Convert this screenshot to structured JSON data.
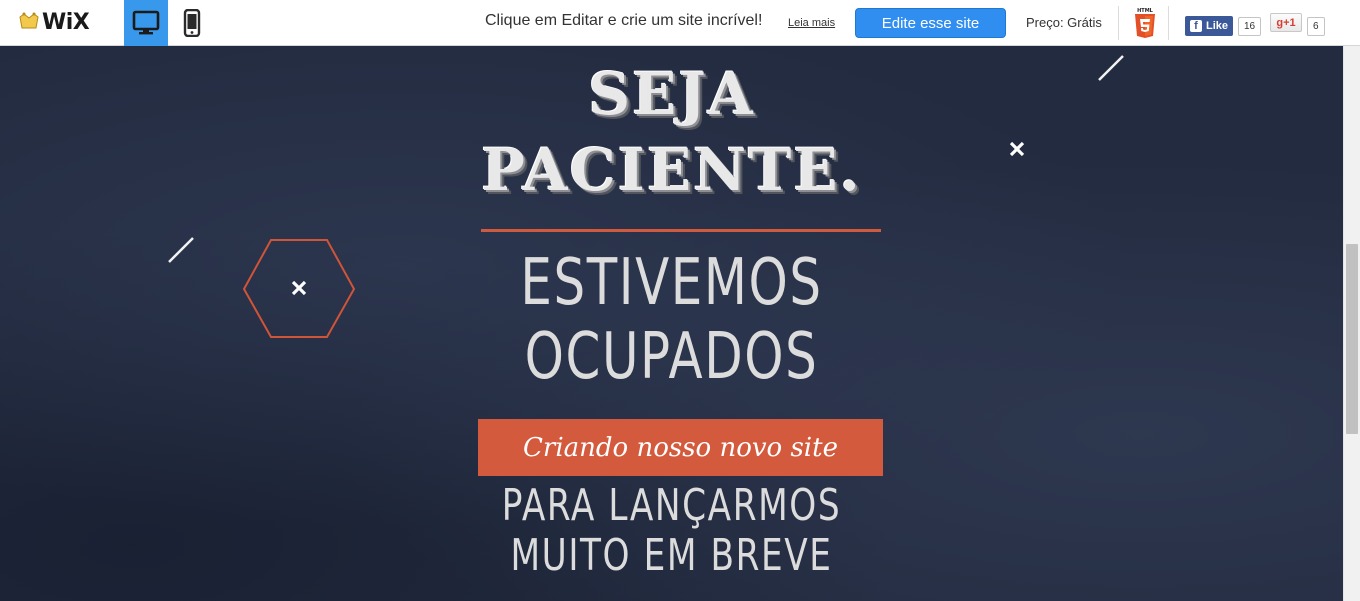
{
  "toolbar": {
    "logo_text": "WiX",
    "device_desktop": "desktop-icon",
    "device_mobile": "mobile-icon",
    "promo_text": "Clique em Editar e crie um site incrível!",
    "more_link": "Leia mais",
    "edit_button": "Edite esse site",
    "price_text": "Preço: Grátis",
    "html5_label": "HTML",
    "fb_like_label": "Like",
    "fb_count": "16",
    "gplus_label": "g+1",
    "gplus_count": "6"
  },
  "site": {
    "headline_line1": "SEJA",
    "headline_line2": "PACIENTE.",
    "line_busy_1": "ESTIVEMOS",
    "line_busy_2": "OCUPADOS",
    "banner_text": "Criando nosso novo site",
    "line_launch_1": "PARA LANÇARMOS",
    "line_launch_2": "MUITO EM BREVE"
  },
  "colors": {
    "accent": "#d45a3d",
    "background": "#232b40",
    "edit_button": "#2f8ef0",
    "facebook": "#3b5998"
  }
}
